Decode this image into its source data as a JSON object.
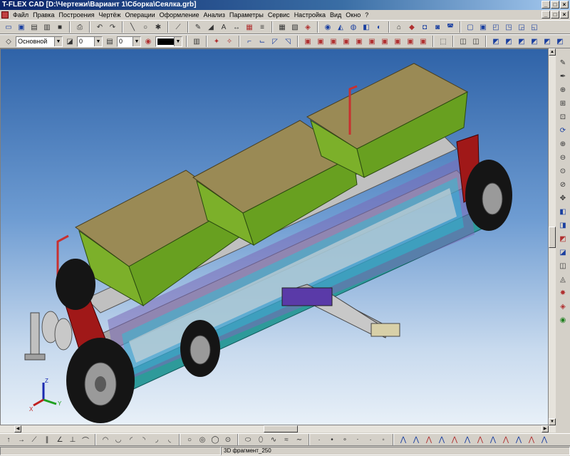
{
  "window": {
    "title": "T-FLEX CAD [D:\\Чертежи\\Вариант 1\\Сборка\\Сеялка.grb]",
    "buttons": [
      "_",
      "□",
      "×"
    ]
  },
  "menu": [
    "Файл",
    "Правка",
    "Построения",
    "Чертёж",
    "Операции",
    "Оформление",
    "Анализ",
    "Параметры",
    "Сервис",
    "Настройка",
    "Вид",
    "Окно",
    "?"
  ],
  "toolbar2": {
    "layer_value": "Основной",
    "level_value": "0",
    "priority_value": "0"
  },
  "triad": {
    "z": "Z",
    "y": "Y",
    "x": "X"
  },
  "statusbar": {
    "text": "3D фрагмент_250"
  },
  "colors": {
    "hopper": "#7cb02a",
    "lid": "#9a8a55",
    "frame": "#b8b8b8",
    "wheel_panel": "#a01818",
    "viewport_top": "#2f63a8"
  }
}
